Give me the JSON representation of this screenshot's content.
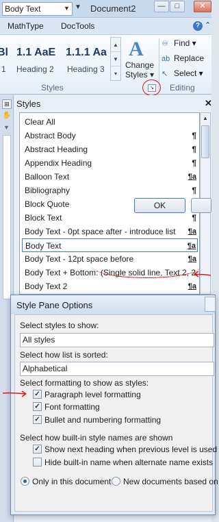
{
  "titlebar": {
    "style_combo_value": "Body Text",
    "doc_title": "Document2",
    "minimize_glyph": "—",
    "maximize_glyph": "□",
    "close_glyph": "✕",
    "qat_glyph": "▼",
    "combo_arrow": "▼"
  },
  "ribbon": {
    "tabs": [
      {
        "label": "MathType"
      },
      {
        "label": "DocTools"
      }
    ],
    "help_glyph": "?",
    "minimize_ribbon_glyph": "⌃",
    "gallery": [
      {
        "sample": "Bl",
        "label": "1"
      },
      {
        "sample": "1.1  AaE",
        "label": "Heading 2"
      },
      {
        "sample": "1.1.1  Aa",
        "label": "Heading 3"
      }
    ],
    "gallery_scroll": {
      "up": "▲",
      "down": "▼",
      "more": "▾"
    },
    "change_styles": {
      "icon_glyph": "A",
      "label": "Change Styles ▾"
    },
    "editing": {
      "find": "Find ▾",
      "replace": "Replace",
      "select": "Select ▾"
    },
    "groups": {
      "styles": "Styles",
      "editing": "Editing"
    },
    "launcher_glyph": "↘"
  },
  "left_strip": {
    "btn1_glyph": "⊞",
    "btn2_glyph": "✋",
    "arrow_glyph": "▼"
  },
  "styles_pane": {
    "title": "Styles",
    "close_glyph": "✕",
    "scroll_up_glyph": "▲",
    "items": [
      {
        "name": "Clear All",
        "mark": "",
        "link": false
      },
      {
        "name": "Abstract Body",
        "mark": "¶",
        "link": false
      },
      {
        "name": "Abstract Heading",
        "mark": "¶",
        "link": false
      },
      {
        "name": "Appendix Heading",
        "mark": "¶",
        "link": false
      },
      {
        "name": "Balloon Text",
        "mark": "¶a",
        "link": true
      },
      {
        "name": "Bibliography",
        "mark": "¶",
        "link": false
      },
      {
        "name": "Block Quote",
        "mark": "¶",
        "link": false
      },
      {
        "name": "Block Text",
        "mark": "¶",
        "link": false
      },
      {
        "name": "Body Text - 0pt space after - introduce list",
        "mark": "¶a",
        "link": true
      },
      {
        "name": "Body Text",
        "mark": "¶a",
        "link": true,
        "selected": true
      },
      {
        "name": "Body Text - 12pt space before",
        "mark": "¶a",
        "link": true
      },
      {
        "name": "Body Text + Bottom: (Single solid line, Text 2,  2.…",
        "mark": "",
        "link": false
      },
      {
        "name": "Body Text 2",
        "mark": "¶a",
        "link": true
      }
    ]
  },
  "dialog": {
    "title": "Style Pane Options",
    "select_styles_label": "Select styles to show:",
    "select_styles_value": "All styles",
    "sort_label": "Select how list is sorted:",
    "sort_value": "Alphabetical",
    "formatting_label": "Select formatting to show as styles:",
    "checkboxes": [
      {
        "label": "Paragraph level formatting",
        "checked": true
      },
      {
        "label": "Font formatting",
        "checked": true
      },
      {
        "label": "Bullet and numbering formatting",
        "checked": true
      }
    ],
    "builtin_label": "Select how built-in style names are shown",
    "builtin_checkboxes": [
      {
        "label": "Show next heading when previous level is used",
        "checked": true
      },
      {
        "label": "Hide built-in name when alternate name exists",
        "checked": false
      }
    ],
    "radios": [
      {
        "label": "Only in this document",
        "selected": true
      },
      {
        "label": "New documents based on th",
        "selected": false
      }
    ],
    "ok_label": "OK",
    "check_glyph": "✓"
  }
}
